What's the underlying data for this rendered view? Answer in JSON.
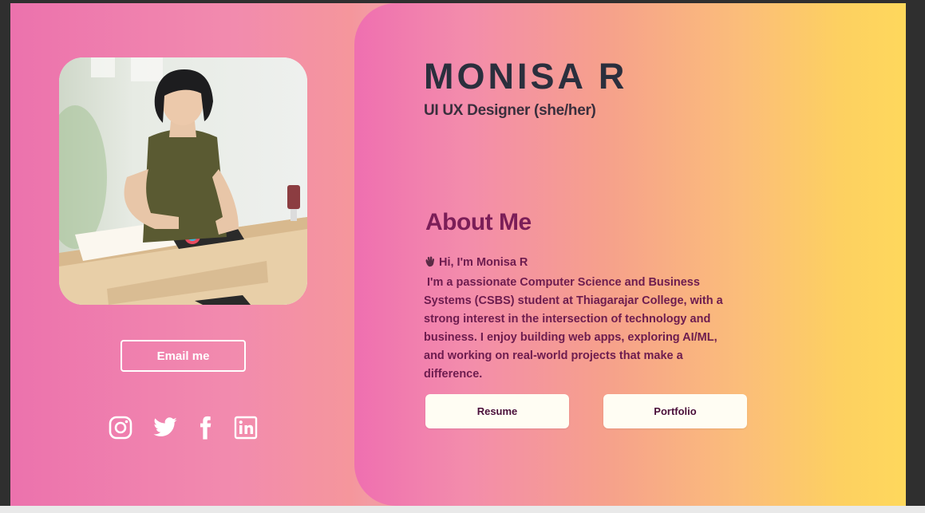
{
  "profile": {
    "name": "MONISA R",
    "role": "UI UX Designer (she/her)",
    "photo_icon": "person-photo"
  },
  "contact": {
    "email_label": "Email me"
  },
  "socials": [
    {
      "icon": "instagram-icon"
    },
    {
      "icon": "twitter-icon"
    },
    {
      "icon": "facebook-icon"
    },
    {
      "icon": "linkedin-icon"
    }
  ],
  "about": {
    "title": "About Me",
    "greeting": "Hi, I'm Monisa R",
    "greeting_icon": "waving-hand-icon",
    "bio": " I'm a passionate Computer Science and Business Systems (CSBS) student at Thiagarajar College, with a strong interest in the intersection of technology and business. I enjoy building web apps, exploring AI/ML, and working on real-world projects that make a difference."
  },
  "actions": {
    "resume_label": "Resume",
    "portfolio_label": "Portfolio"
  },
  "colors": {
    "left_pink": "#ec72ad",
    "right_yellow": "#fed85c",
    "name_text": "#2b2f3d",
    "about_text": "#7b1e58",
    "button_bg": "#fffdf3"
  }
}
